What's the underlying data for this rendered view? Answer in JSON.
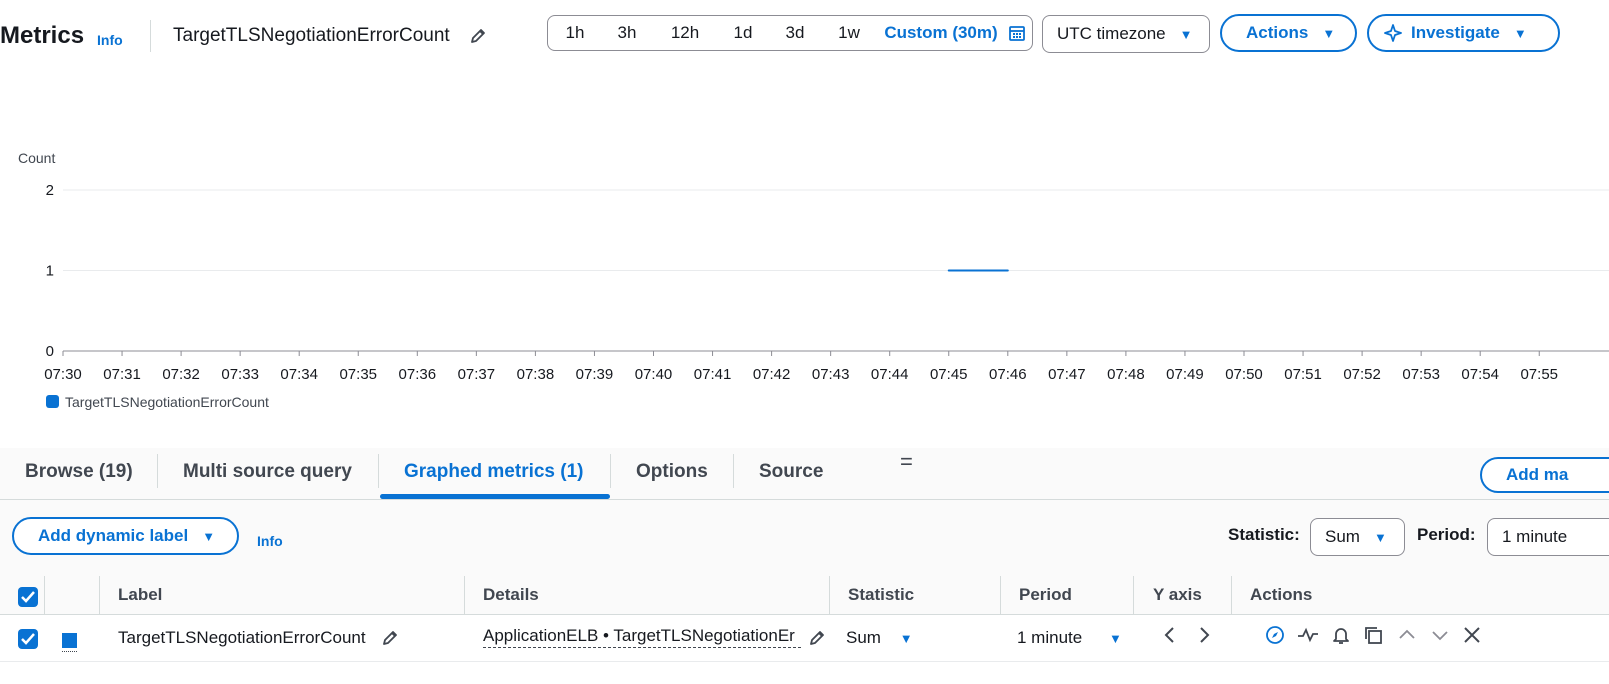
{
  "header": {
    "title": "Metrics",
    "info": "Info",
    "metric_name": "TargetTLSNegotiationErrorCount",
    "ranges": [
      "1h",
      "3h",
      "12h",
      "1d",
      "3d",
      "1w"
    ],
    "custom_range": "Custom (30m)",
    "timezone": "UTC timezone",
    "actions": "Actions",
    "investigate": "Investigate"
  },
  "chart_data": {
    "type": "line",
    "ylabel": "Count",
    "ylim": [
      0,
      2
    ],
    "yticks": [
      "0",
      "1",
      "2"
    ],
    "x": [
      "07:30",
      "07:31",
      "07:32",
      "07:33",
      "07:34",
      "07:35",
      "07:36",
      "07:37",
      "07:38",
      "07:39",
      "07:40",
      "07:41",
      "07:42",
      "07:43",
      "07:44",
      "07:45",
      "07:46",
      "07:47",
      "07:48",
      "07:49",
      "07:50",
      "07:51",
      "07:52",
      "07:53",
      "07:54",
      "07:55"
    ],
    "series": [
      {
        "name": "TargetTLSNegotiationErrorCount",
        "color": "#0972d3",
        "points": [
          {
            "x": "07:45",
            "y": 1
          },
          {
            "x": "07:46",
            "y": 1
          }
        ]
      }
    ],
    "grid": true,
    "legend": "bottom-left"
  },
  "tabs": [
    "Browse (19)",
    "Multi source query",
    "Graphed metrics (1)",
    "Options",
    "Source"
  ],
  "drag_handle": "=",
  "add_math": "Add ma",
  "controls": {
    "add_dynamic_label": "Add dynamic label",
    "info": "Info",
    "statistic_label": "Statistic:",
    "statistic_value": "Sum",
    "period_label": "Period:",
    "period_value": "1 minute"
  },
  "table": {
    "headers": [
      "Label",
      "Details",
      "Statistic",
      "Period",
      "Y axis",
      "Actions"
    ],
    "rows": [
      {
        "label": "TargetTLSNegotiationErrorCount",
        "details": "ApplicationELB • TargetTLSNegotiationEr",
        "statistic": "Sum",
        "period": "1 minute",
        "color": "#0972d3"
      }
    ]
  }
}
